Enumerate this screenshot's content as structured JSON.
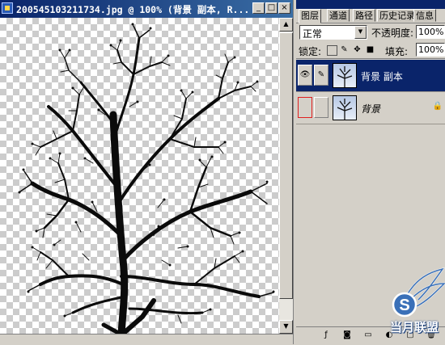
{
  "document": {
    "title": "200545103211734.jpg @ 100% (背景 副本, R...",
    "buttons": {
      "minimize": "_",
      "maximize": "□",
      "close": "×"
    }
  },
  "panel": {
    "tabs": [
      "图层",
      "通道",
      "路径",
      "历史记录",
      "信息"
    ],
    "active_tab": "图层",
    "blend_mode": "正常",
    "opacity_label": "不透明度:",
    "opacity_value": "100%",
    "lock_label": "锁定:",
    "fill_label": "填充:",
    "fill_value": "100%",
    "layers": [
      {
        "name": "背景 副本",
        "visible": true,
        "selected": true
      },
      {
        "name": "背景",
        "visible": false,
        "selected": false,
        "locked": true
      }
    ]
  },
  "watermark": "当月联盟",
  "colors": {
    "titlebar": "#0a246a",
    "selection": "#0a246a",
    "chrome": "#d4d0c8",
    "tree": "#0b0b0b",
    "highlight_box": "#e02020"
  },
  "icons": [
    "eye-icon",
    "brush-link-icon",
    "lock-icon",
    "layer-style-icon",
    "mask-icon",
    "new-set-icon",
    "adjustment-layer-icon",
    "new-layer-icon",
    "trash-icon"
  ]
}
